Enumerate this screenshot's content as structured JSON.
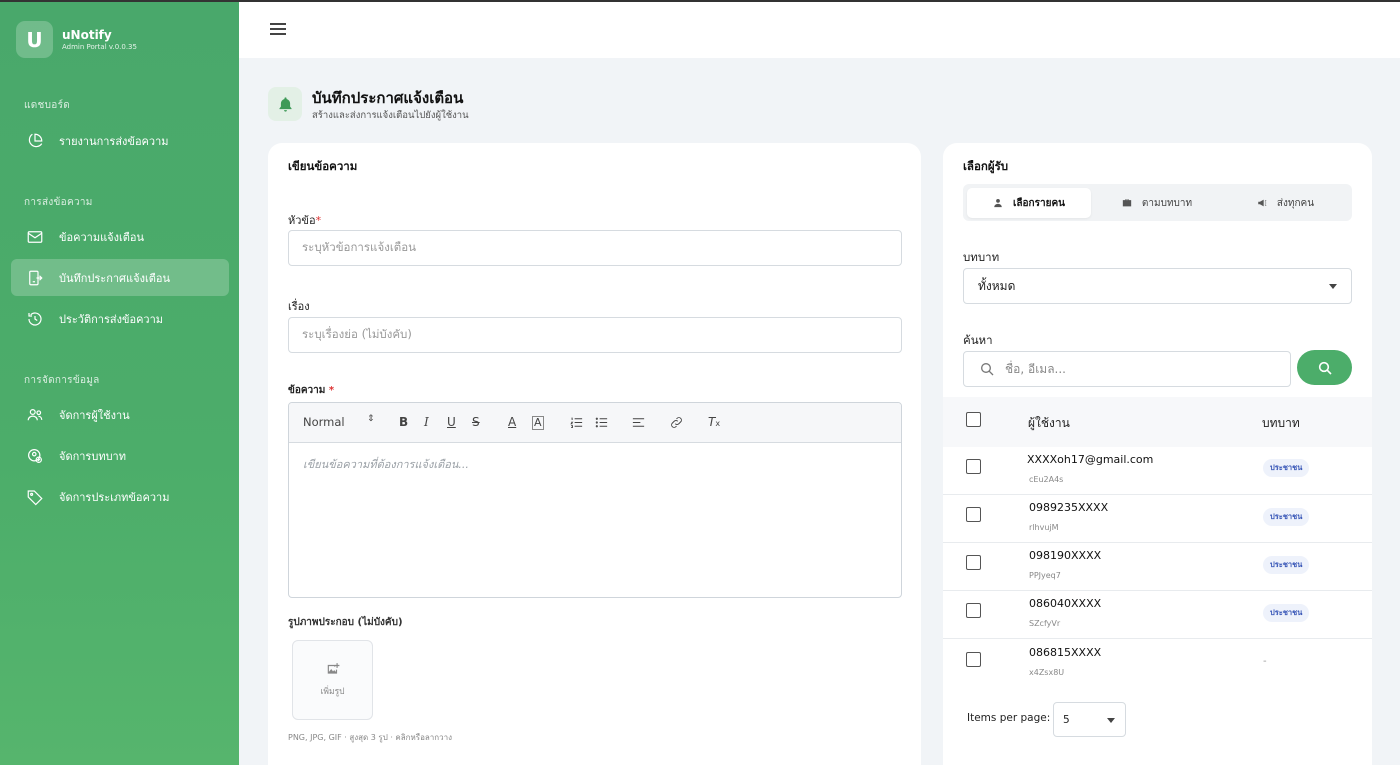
{
  "brand": {
    "logo_letter": "U",
    "name": "uNotify",
    "subtitle": "Admin Portal v.0.0.35"
  },
  "sidebar": {
    "sections": [
      {
        "label": "แดชบอร์ด"
      },
      {
        "label": "การส่งข้อความ"
      },
      {
        "label": "การจัดการข้อมูล"
      }
    ],
    "items": [
      {
        "label": "รายงานการส่งข้อความ",
        "icon": "pie-chart-icon"
      },
      {
        "label": "ข้อความแจ้งเตือน",
        "icon": "mail-icon"
      },
      {
        "label": "บันทึกประกาศแจ้งเตือน",
        "icon": "announcement-icon",
        "active": true
      },
      {
        "label": "ประวัติการส่งข้อความ",
        "icon": "history-icon"
      },
      {
        "label": "จัดการผู้ใช้งาน",
        "icon": "users-icon"
      },
      {
        "label": "จัดการบทบาท",
        "icon": "role-icon"
      },
      {
        "label": "จัดการประเภทข้อความ",
        "icon": "tag-icon"
      }
    ]
  },
  "page": {
    "title": "บันทึกประกาศแจ้งเตือน",
    "subtitle": "สร้างและส่งการแจ้งเตือนไปยังผู้ใช้งาน"
  },
  "compose": {
    "card_title": "เขียนข้อความ",
    "subject_label": "หัวข้อ",
    "subject_placeholder": "ระบุหัวข้อการแจ้งเตือน",
    "topic_label": "เรื่อง",
    "topic_placeholder": "ระบุเรื่องย่อ (ไม่บังคับ)",
    "message_label": "ข้อความ",
    "format_select": "Normal",
    "editor_placeholder": "เขียนข้อความที่ต้องการแจ้งเตือน...",
    "image_label": "รูปภาพประกอบ (ไม่บังคับ)",
    "add_image": "เพิ่มรูป",
    "image_hint": "PNG, JPG, GIF · สูงสุด 3 รูป · คลิกหรือลากวาง"
  },
  "recipients": {
    "card_title": "เลือกผู้รับ",
    "tabs": [
      {
        "label": "เลือกรายคน",
        "active": true
      },
      {
        "label": "ตามบทบาท"
      },
      {
        "label": "ส่งทุกคน"
      }
    ],
    "role_label": "บทบาท",
    "role_value": "ทั้งหมด",
    "search_label": "ค้นหา",
    "search_placeholder": "ชื่อ, อีเมล...",
    "columns": {
      "user": "ผู้ใช้งาน",
      "role": "บทบาท"
    },
    "rows": [
      {
        "name": "XXXXoh17@gmail.com",
        "id": "cEu2A4s",
        "role": "ประชาชน"
      },
      {
        "name": "0989235XXXX",
        "id": "rlhvujM",
        "role": "ประชาชน"
      },
      {
        "name": "098190XXXX",
        "id": "PPJyeq7",
        "role": "ประชาชน"
      },
      {
        "name": "086040XXXX",
        "id": "SZcfyVr",
        "role": "ประชาชน"
      },
      {
        "name": "086815XXXX",
        "id": "x4Zsx8U",
        "role": "-"
      }
    ],
    "items_per_page_label": "Items per page:",
    "items_per_page_value": "5"
  },
  "colors": {
    "primary_green": "#4cad6a",
    "badge_blue": "#3a58b8"
  }
}
